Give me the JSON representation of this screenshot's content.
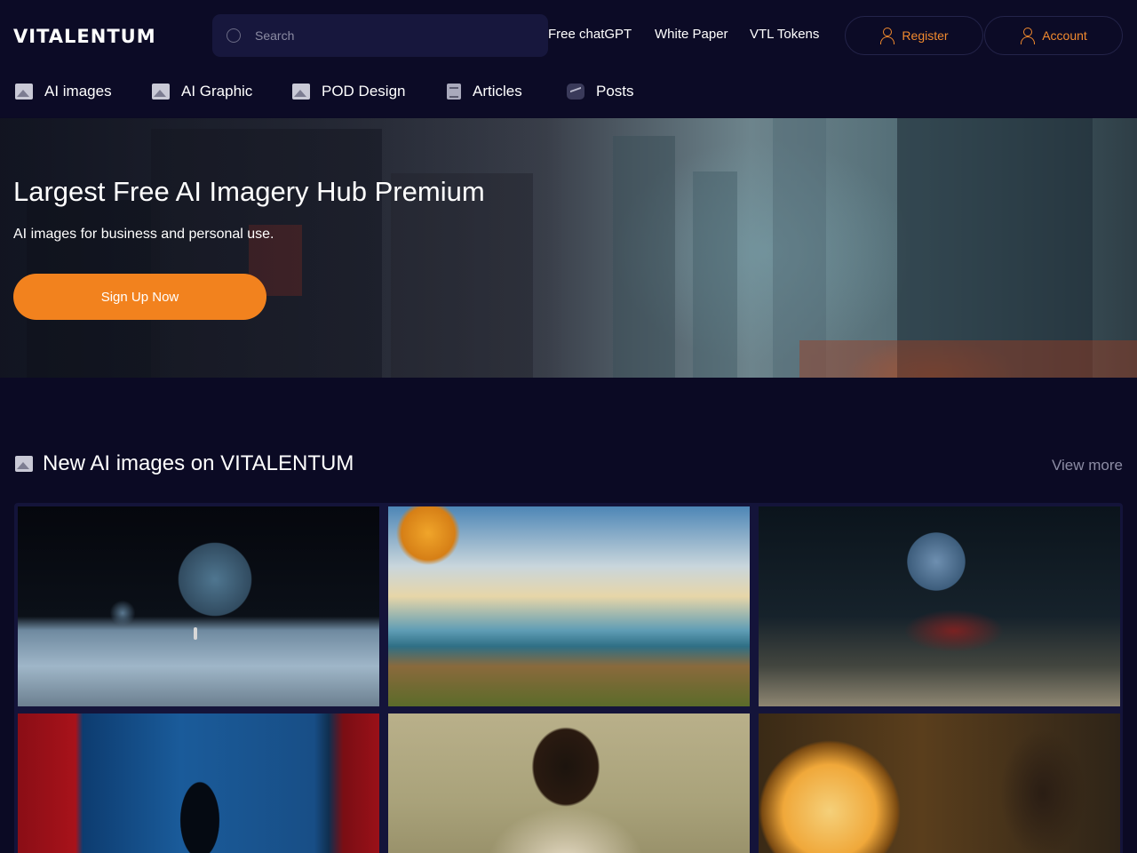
{
  "header": {
    "logo": "VITALENTUM",
    "search_placeholder": "Search",
    "links": [
      "Free chatGPT",
      "White Paper",
      "VTL Tokens"
    ],
    "register_label": "Register",
    "account_label": "Account"
  },
  "categories": [
    {
      "label": "AI images",
      "icon": "image-icon"
    },
    {
      "label": "AI Graphic",
      "icon": "image-icon"
    },
    {
      "label": "POD Design",
      "icon": "image-icon"
    },
    {
      "label": "Articles",
      "icon": "document-icon"
    },
    {
      "label": "Posts",
      "icon": "trend-icon"
    }
  ],
  "hero": {
    "title": "Largest Free AI Imagery Hub Premium",
    "subtitle": "AI images for business and personal use.",
    "cta_label": "Sign Up Now"
  },
  "section": {
    "title": "New AI images on VITALENTUM",
    "view_more": "View more"
  },
  "colors": {
    "background": "#0b0a24",
    "accent": "#f2821e",
    "muted_text": "#8c8ca4"
  }
}
